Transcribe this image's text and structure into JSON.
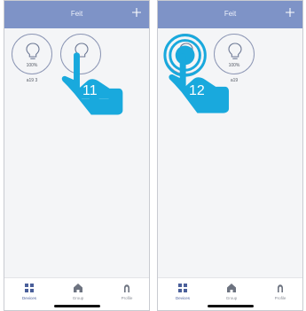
{
  "screens": [
    {
      "title": "Feit",
      "add_icon": "plus-icon",
      "devices": [
        {
          "name": "a19 3",
          "percent": "100%",
          "icon": "bulb-icon"
        },
        {
          "name": "",
          "percent": "",
          "icon": "bulb-icon"
        }
      ],
      "step": "11",
      "gesture": "tap-hand-icon",
      "tabs": [
        {
          "label": "Devices",
          "icon": "grid-icon"
        },
        {
          "label": "Group",
          "icon": "home-icon"
        },
        {
          "label": "Profile",
          "icon": "profile-icon"
        }
      ]
    },
    {
      "title": "Feit",
      "add_icon": "plus-icon",
      "devices": [
        {
          "name": "",
          "percent": "",
          "icon": "bulb-icon"
        },
        {
          "name": "a19",
          "percent": "100%",
          "icon": "bulb-icon"
        }
      ],
      "step": "12",
      "gesture": "press-hand-icon",
      "tabs": [
        {
          "label": "Devices",
          "icon": "grid-icon"
        },
        {
          "label": "Group",
          "icon": "home-icon"
        },
        {
          "label": "Profile",
          "icon": "profile-icon"
        }
      ]
    }
  ],
  "colors": {
    "navbar": "#7e93c7",
    "accent": "#4a5f9a",
    "gesture": "#19a9dd",
    "background": "#f4f5f7"
  }
}
